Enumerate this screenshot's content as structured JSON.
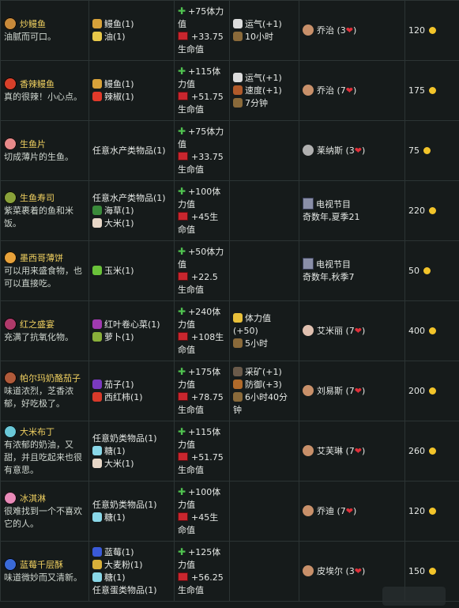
{
  "rows": [
    {
      "dish": {
        "name": "炒鳗鱼",
        "desc": "油腻而可口。",
        "color": "#c98a3a"
      },
      "ing": [
        {
          "t": "鳗鱼(1)",
          "c": "#d8a23a"
        },
        {
          "t": "油(1)",
          "c": "#e8c84a"
        }
      ],
      "energy": "+75体力值",
      "health": "+33.75生命值",
      "buffs": [
        {
          "t": "运气(+1)",
          "c": "#dcdcdc"
        },
        {
          "t": "10小时",
          "c": "#8a6a3a"
        }
      ],
      "gift": "乔治 (3",
      "price": "120"
    },
    {
      "dish": {
        "name": "香辣鳗鱼",
        "desc": "真的很辣！小心点。",
        "color": "#d8402a"
      },
      "ing": [
        {
          "t": "鳗鱼(1)",
          "c": "#d8a23a"
        },
        {
          "t": "辣椒(1)",
          "c": "#e23a2a"
        }
      ],
      "energy": "+115体力值",
      "health": "+51.75生命值",
      "buffs": [
        {
          "t": "运气(+1)",
          "c": "#dcdcdc"
        },
        {
          "t": "速度(+1)",
          "c": "#b05a2a"
        },
        {
          "t": "7分钟",
          "c": "#8a6a3a"
        }
      ],
      "gift": "乔治 (7",
      "price": "175"
    },
    {
      "dish": {
        "name": "生鱼片",
        "desc": "切成薄片的生鱼。",
        "color": "#e88a8a"
      },
      "ing": [
        {
          "t": "任意水产类物品(1)",
          "c": ""
        }
      ],
      "energy": "+75体力值",
      "health": "+33.75生命值",
      "buffs": [],
      "gift": "莱纳斯 (3",
      "price": "75"
    },
    {
      "dish": {
        "name": "生鱼寿司",
        "desc": "紫菜裹着的鱼和米饭。",
        "color": "#8aa23a"
      },
      "ing": [
        {
          "t": "任意水产类物品(1)",
          "c": ""
        },
        {
          "t": "海草(1)",
          "c": "#3a8a3a"
        },
        {
          "t": "大米(1)",
          "c": "#e8d8c8"
        }
      ],
      "energy": "+100体力值",
      "health": "+45生命值",
      "buffs": [],
      "tv": {
        "title": "电视节目",
        "sub": "奇数年,夏季21"
      },
      "price": "220"
    },
    {
      "dish": {
        "name": "墨西哥薄饼",
        "desc": "可以用来盛食物，也可以直接吃。",
        "color": "#e8a23a"
      },
      "ing": [
        {
          "t": "玉米(1)",
          "c": "#6ac23a"
        }
      ],
      "energy": "+50体力值",
      "health": "+22.5生命值",
      "buffs": [],
      "tv": {
        "title": "电视节目",
        "sub": "奇数年,秋季7"
      },
      "price": "50"
    },
    {
      "dish": {
        "name": "红之盛宴",
        "desc": "充满了抗氧化物。",
        "color": "#b03a6a"
      },
      "ing": [
        {
          "t": "红叶卷心菜(1)",
          "c": "#a03ab0"
        },
        {
          "t": "萝卜(1)",
          "c": "#8ab03a"
        }
      ],
      "energy": "+240体力值",
      "health": "+108生命值",
      "buffs": [
        {
          "t": "体力值(+50)",
          "c": "#e8c03a"
        },
        {
          "t": "5小时",
          "c": "#8a6a3a"
        }
      ],
      "gift": "艾米丽 (7",
      "price": "400"
    },
    {
      "dish": {
        "name": "帕尔玛奶酪茄子",
        "desc": "味道浓烈，芝香浓郁，好吃极了。",
        "color": "#b05a3a"
      },
      "ing": [
        {
          "t": "茄子(1)",
          "c": "#7a3ac0"
        },
        {
          "t": "西红柿(1)",
          "c": "#d83a2a"
        }
      ],
      "energy": "+175体力值",
      "health": "+78.75生命值",
      "buffs": [
        {
          "t": "采矿(+1)",
          "c": "#6a5a4a"
        },
        {
          "t": "防御(+3)",
          "c": "#b06a2a"
        },
        {
          "t": "6小时40分钟",
          "c": "#8a6a3a"
        }
      ],
      "gift": "刘易斯 (7",
      "price": "200"
    },
    {
      "dish": {
        "name": "大米布丁",
        "desc": "有浓郁的奶油，又甜，并且吃起来也很有意思。",
        "color": "#6ac8d8"
      },
      "ing": [
        {
          "t": "任意奶类物品(1)",
          "c": ""
        },
        {
          "t": "糖(1)",
          "c": "#8ad8e8"
        },
        {
          "t": "大米(1)",
          "c": "#e8d8c8"
        }
      ],
      "energy": "+115体力值",
      "health": "+51.75生命值",
      "buffs": [],
      "gift": "艾芙琳 (7",
      "price": "260"
    },
    {
      "dish": {
        "name": "冰淇淋",
        "desc": "很难找到一个不喜欢它的人。",
        "color": "#e88ab8"
      },
      "ing": [
        {
          "t": "任意奶类物品(1)",
          "c": ""
        },
        {
          "t": "糖(1)",
          "c": "#8ad8e8"
        }
      ],
      "energy": "+100体力值",
      "health": "+45生命值",
      "buffs": [],
      "gift": "乔迪 (7",
      "price": "120"
    },
    {
      "dish": {
        "name": "蓝莓千层酥",
        "desc": "味道微妙而又清新。",
        "color": "#3a6ad8"
      },
      "ing": [
        {
          "t": "蓝莓(1)",
          "c": "#3a5ad8"
        },
        {
          "t": "大麦粉(1)",
          "c": "#d8b03a"
        },
        {
          "t": "糖(1)",
          "c": "#8ad8e8"
        },
        {
          "t": "任意蛋类物品(1)",
          "c": ""
        }
      ],
      "energy": "+125体力值",
      "health": "+56.25生命值",
      "buffs": [],
      "gift": "皮埃尔 (3",
      "price": "150"
    }
  ],
  "colors": {
    "dish_name": "#f0d060",
    "energy_plus": "#4fc24f",
    "health": "#c8262e",
    "heart": "#e0303a",
    "coin": "#f2c42a"
  }
}
